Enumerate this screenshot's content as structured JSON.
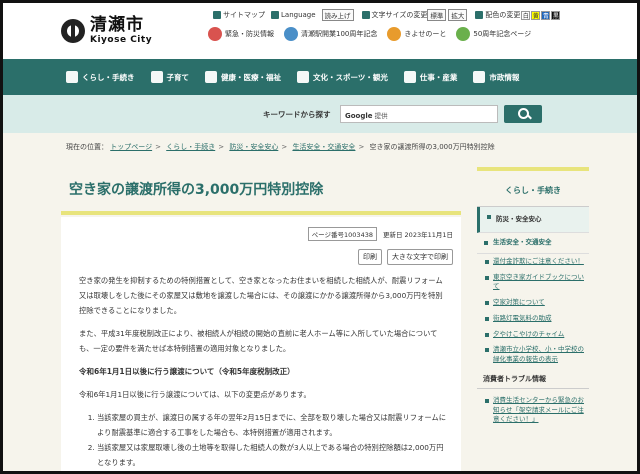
{
  "header": {
    "logo_ja": "清瀬市",
    "logo_en": "Kiyose City",
    "util": {
      "sitemap": "サイトマップ",
      "language": "Language",
      "readaloud": "読み上げ",
      "fontsize_label": "文字サイズの変更",
      "fontsize_normal": "標準",
      "fontsize_large": "拡大",
      "color_label": "配色の変更",
      "color_opts": [
        "白",
        "黄",
        "青",
        "黒"
      ]
    },
    "banners": [
      {
        "label": "緊急・防災情報",
        "color": "#d9534f"
      },
      {
        "label": "清瀬駅開業100周年記念",
        "color": "#4a8fc8"
      },
      {
        "label": "きよせのーと",
        "color": "#e89b2c"
      },
      {
        "label": "50周年記念ページ",
        "color": "#6ab04c"
      }
    ]
  },
  "nav": {
    "items": [
      {
        "label": "くらし・手続き",
        "icon": "house-icon"
      },
      {
        "label": "子育て",
        "icon": "child-icon"
      },
      {
        "label": "健康・医療・福祉",
        "icon": "health-icon"
      },
      {
        "label": "文化・スポーツ・観光",
        "icon": "runner-icon"
      },
      {
        "label": "仕事・産業",
        "icon": "briefcase-icon"
      },
      {
        "label": "市政情報",
        "icon": "city-icon"
      }
    ]
  },
  "search": {
    "label": "キーワードから探す",
    "brand": "Google",
    "placeholder": "提供"
  },
  "breadcrumb": {
    "prefix": "現在の位置：",
    "items": [
      "トップページ",
      "くらし・手続き",
      "防災・安全安心",
      "生活安全・交通安全"
    ],
    "current": "空き家の譲渡所得の3,000万円特別控除"
  },
  "page": {
    "title": "空き家の譲渡所得の3,000万円特別控除",
    "page_no": "ページ番号1003438",
    "updated": "更新日 2023年11月1日",
    "print": "印刷",
    "print_large": "大きな文字で印刷",
    "p1": "空き家の発生を抑制するための特例措置として、空き家となったお住まいを相続した相続人が、耐震リフォーム又は取壊しをした後にその家屋又は敷地を譲渡した場合には、その譲渡にかかる譲渡所得から3,000万円を特別控除できることになりました。",
    "p2": "また、平成31年度税制改正により、被相続人が相続の開始の直前に老人ホーム等に入所していた場合についても、一定の要件を満たせば本特例措置の適用対象となりました。",
    "h3": "令和6年1月1日以後に行う譲渡について（令和5年度税制改正）",
    "p3": "令和6年1月1日以後に行う譲渡については、以下の変更点があります。",
    "list": [
      "当該家屋の買主が、譲渡日の属する年の翌年2月15日までに、全部を取り壊した場合又は耐震リフォームにより耐震基準に適合する工事をした場合も、本特例措置が適用されます。",
      "当該家屋又は家屋取壊し後の土地等を取得した相続人の数が3人以上である場合の特別控除額は2,000万円となります。"
    ]
  },
  "sidebar": {
    "header": "くらし・手続き",
    "active": "防災・安全安心",
    "section": "生活安全・交通安全",
    "subitems": [
      "還付金詐欺にご注意ください！",
      "東京空き家ガイドブックについて",
      "空家対策について",
      "街路灯電気料の助成",
      "夕やけこやけのチャイム",
      "清瀬市立小学校、小・中学校の緑化事業の報告の表示"
    ],
    "group": "消費者トラブル情報",
    "group_items": [
      "消費生活センターから緊急のお知らせ「架空請求メールにご注意ください！」"
    ]
  }
}
